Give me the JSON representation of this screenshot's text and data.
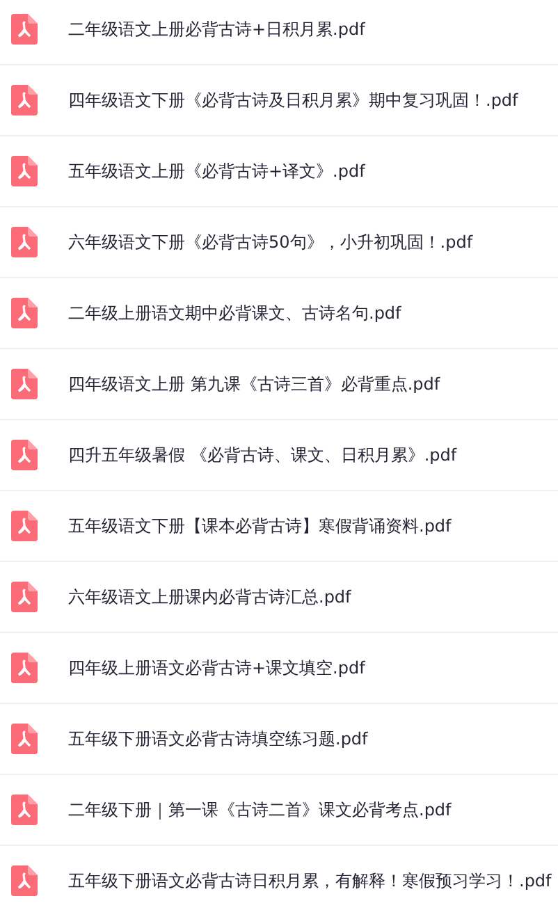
{
  "files": [
    {
      "name": "二年级语文上册必背古诗+日积月累.pdf"
    },
    {
      "name": "四年级语文下册《必背古诗及日积月累》期中复习巩固！.pdf"
    },
    {
      "name": "五年级语文上册《必背古诗+译文》.pdf"
    },
    {
      "name": "六年级语文下册《必背古诗50句》，小升初巩固！.pdf"
    },
    {
      "name": "二年级上册语文期中必背课文、古诗名句.pdf"
    },
    {
      "name": "四年级语文上册 第九课《古诗三首》必背重点.pdf"
    },
    {
      "name": "四升五年级暑假 《必背古诗、课文、日积月累》.pdf"
    },
    {
      "name": "五年级语文下册【课本必背古诗】寒假背诵资料.pdf"
    },
    {
      "name": "六年级语文上册课内必背古诗汇总.pdf"
    },
    {
      "name": "四年级上册语文必背古诗+课文填空.pdf"
    },
    {
      "name": "五年级下册语文必背古诗填空练习题.pdf"
    },
    {
      "name": "二年级下册｜第一课《古诗二首》课文必背考点.pdf"
    },
    {
      "name": "五年级下册语文必背古诗日积月累，有解释！寒假预习学习！.pdf"
    }
  ]
}
